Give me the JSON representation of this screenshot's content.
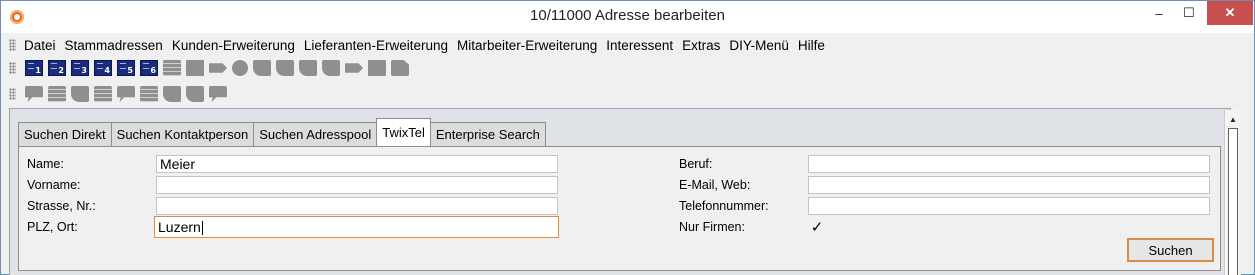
{
  "window": {
    "title": "10/11000 Adresse bearbeiten",
    "controls": {
      "minimize": "–",
      "maximize": "☐",
      "close": "✕"
    }
  },
  "menu": {
    "items": [
      "Datei",
      "Stammadressen",
      "Kunden-Erweiterung",
      "Lieferanten-Erweiterung",
      "Mitarbeiter-Erweiterung",
      "Interessent",
      "Extras",
      "DIY-Menü",
      "Hilfe"
    ]
  },
  "toolbar1": {
    "books": [
      "1",
      "2",
      "3",
      "4",
      "5",
      "6"
    ],
    "icons": [
      "printer-icon",
      "envelope-icon",
      "card-icon",
      "mail-icon",
      "pin-icon",
      "copy-icon",
      "note-icon",
      "attach-icon",
      "export-icon",
      "tag-icon",
      "square-icon",
      "document-icon"
    ]
  },
  "toolbar2": {
    "icons": [
      "bubble-icon",
      "list-icon",
      "stack-icon",
      "folder-icon",
      "bubble-icon",
      "list-icon",
      "stack-icon",
      "note-icon",
      "tag-icon"
    ]
  },
  "tabs": {
    "items": [
      "Suchen Direkt",
      "Suchen Kontaktperson",
      "Suchen Adresspool",
      "TwixTel",
      "Enterprise Search"
    ],
    "active": "TwixTel"
  },
  "form": {
    "left": {
      "name": {
        "label": "Name:",
        "value": "Meier"
      },
      "vorname": {
        "label": "Vorname:",
        "value": ""
      },
      "strasse": {
        "label": "Strasse, Nr.:",
        "value": ""
      },
      "plz": {
        "label": "PLZ, Ort:",
        "value": "Luzern"
      }
    },
    "right": {
      "beruf": {
        "label": "Beruf:",
        "value": ""
      },
      "email": {
        "label": "E-Mail, Web:",
        "value": ""
      },
      "telefon": {
        "label": "Telefonnummer:",
        "value": ""
      },
      "nurfirmen": {
        "label": "Nur Firmen:",
        "checked": true,
        "mark": "✓"
      }
    },
    "search_button": "Suchen"
  },
  "colors": {
    "accent": "#e08a3c",
    "close": "#c7504f",
    "panel": "#dfe3e8"
  }
}
